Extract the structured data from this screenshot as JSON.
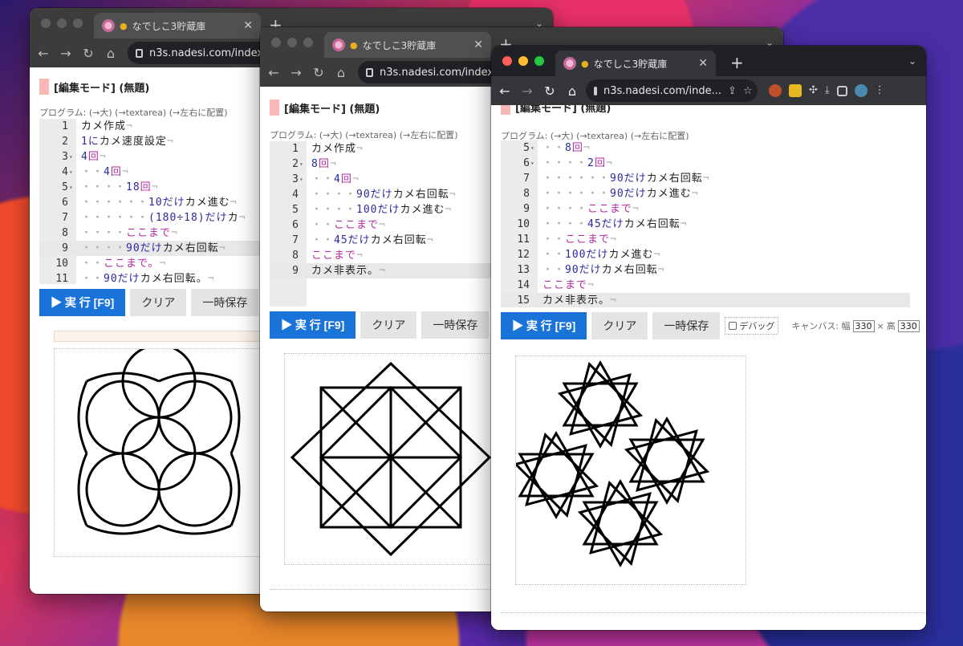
{
  "colors": {
    "run_button": "#1a73d9",
    "keyword_number": "#2a2aa0",
    "keyword_particle": "#b02aa0"
  },
  "windows": [
    {
      "tab_title": "なでしこ3貯蔵庫",
      "url": "n3s.nadesi.com/index.p",
      "header": "[編集モード] (無題)",
      "program_label": "プログラム: (→大) (→textarea) (→左右に配置)",
      "lines": [
        {
          "num": "1",
          "code": "カメ作成",
          "fold": ""
        },
        {
          "num": "2",
          "code": "1にカメ速度設定",
          "fold": ""
        },
        {
          "num": "3",
          "code": "4回",
          "fold": "▾"
        },
        {
          "num": "4",
          "code": "・・4回",
          "fold": "▾"
        },
        {
          "num": "5",
          "code": "・・・・18回",
          "fold": "▾"
        },
        {
          "num": "6",
          "code": "・・・・・・10だけカメ進む",
          "fold": ""
        },
        {
          "num": "7",
          "code": "・・・・・・(180÷18)だけカ",
          "fold": ""
        },
        {
          "num": "8",
          "code": "・・・・ここまで",
          "fold": ""
        },
        {
          "num": "9",
          "code": "・・・・90だけカメ右回転",
          "fold": ""
        },
        {
          "num": "10",
          "code": "・・ここまで。",
          "fold": ""
        },
        {
          "num": "11",
          "code": "・・90だけカメ右回転。",
          "fold": ""
        }
      ],
      "buttons": {
        "run": "▶ 実 行 [F9]",
        "clear": "クリア",
        "save": "一時保存"
      }
    },
    {
      "tab_title": "なでしこ3貯蔵庫",
      "url": "n3s.nadesi.com/index.p",
      "header": "[編集モード] (無題)",
      "program_label": "プログラム: (→大) (→textarea) (→左右に配置)",
      "lines": [
        {
          "num": "1",
          "code": "カメ作成",
          "fold": ""
        },
        {
          "num": "2",
          "code": "8回",
          "fold": "▾"
        },
        {
          "num": "3",
          "code": "・・4回",
          "fold": "▾"
        },
        {
          "num": "4",
          "code": "・・・・90だけカメ右回転",
          "fold": ""
        },
        {
          "num": "5",
          "code": "・・・・100だけカメ進む",
          "fold": ""
        },
        {
          "num": "6",
          "code": "・・ここまで",
          "fold": ""
        },
        {
          "num": "7",
          "code": "・・45だけカメ右回転",
          "fold": ""
        },
        {
          "num": "8",
          "code": "ここまで",
          "fold": ""
        },
        {
          "num": "9",
          "code": "カメ非表示。",
          "fold": ""
        }
      ],
      "buttons": {
        "run": "▶ 実 行 [F9]",
        "clear": "クリア",
        "save": "一時保存"
      }
    },
    {
      "tab_title": "なでしこ3貯蔵庫",
      "url": "n3s.nadesi.com/inde...",
      "header": "[編集モード] (無題)",
      "program_label": "プログラム: (→大) (→textarea) (→左右に配置)",
      "lines": [
        {
          "num": "5",
          "code": "・・8回",
          "fold": "▾"
        },
        {
          "num": "6",
          "code": "・・・・2回",
          "fold": "▾"
        },
        {
          "num": "7",
          "code": "・・・・・・90だけカメ右回転",
          "fold": ""
        },
        {
          "num": "8",
          "code": "・・・・・・90だけカメ進む",
          "fold": ""
        },
        {
          "num": "9",
          "code": "・・・・ここまで",
          "fold": ""
        },
        {
          "num": "10",
          "code": "・・・・45だけカメ右回転",
          "fold": ""
        },
        {
          "num": "11",
          "code": "・・ここまで",
          "fold": ""
        },
        {
          "num": "12",
          "code": "・・100だけカメ進む",
          "fold": ""
        },
        {
          "num": "13",
          "code": "・・90だけカメ右回転",
          "fold": ""
        },
        {
          "num": "14",
          "code": "ここまで",
          "fold": ""
        },
        {
          "num": "15",
          "code": "カメ非表示。",
          "fold": ""
        }
      ],
      "buttons": {
        "run": "▶ 実 行 [F9]",
        "clear": "クリア",
        "save": "一時保存",
        "debug": "デバッグ"
      },
      "canvas_options": {
        "label": "キャンバス: 幅",
        "width": "330",
        "times": "×",
        "height_label": "高",
        "height": "330"
      }
    }
  ]
}
